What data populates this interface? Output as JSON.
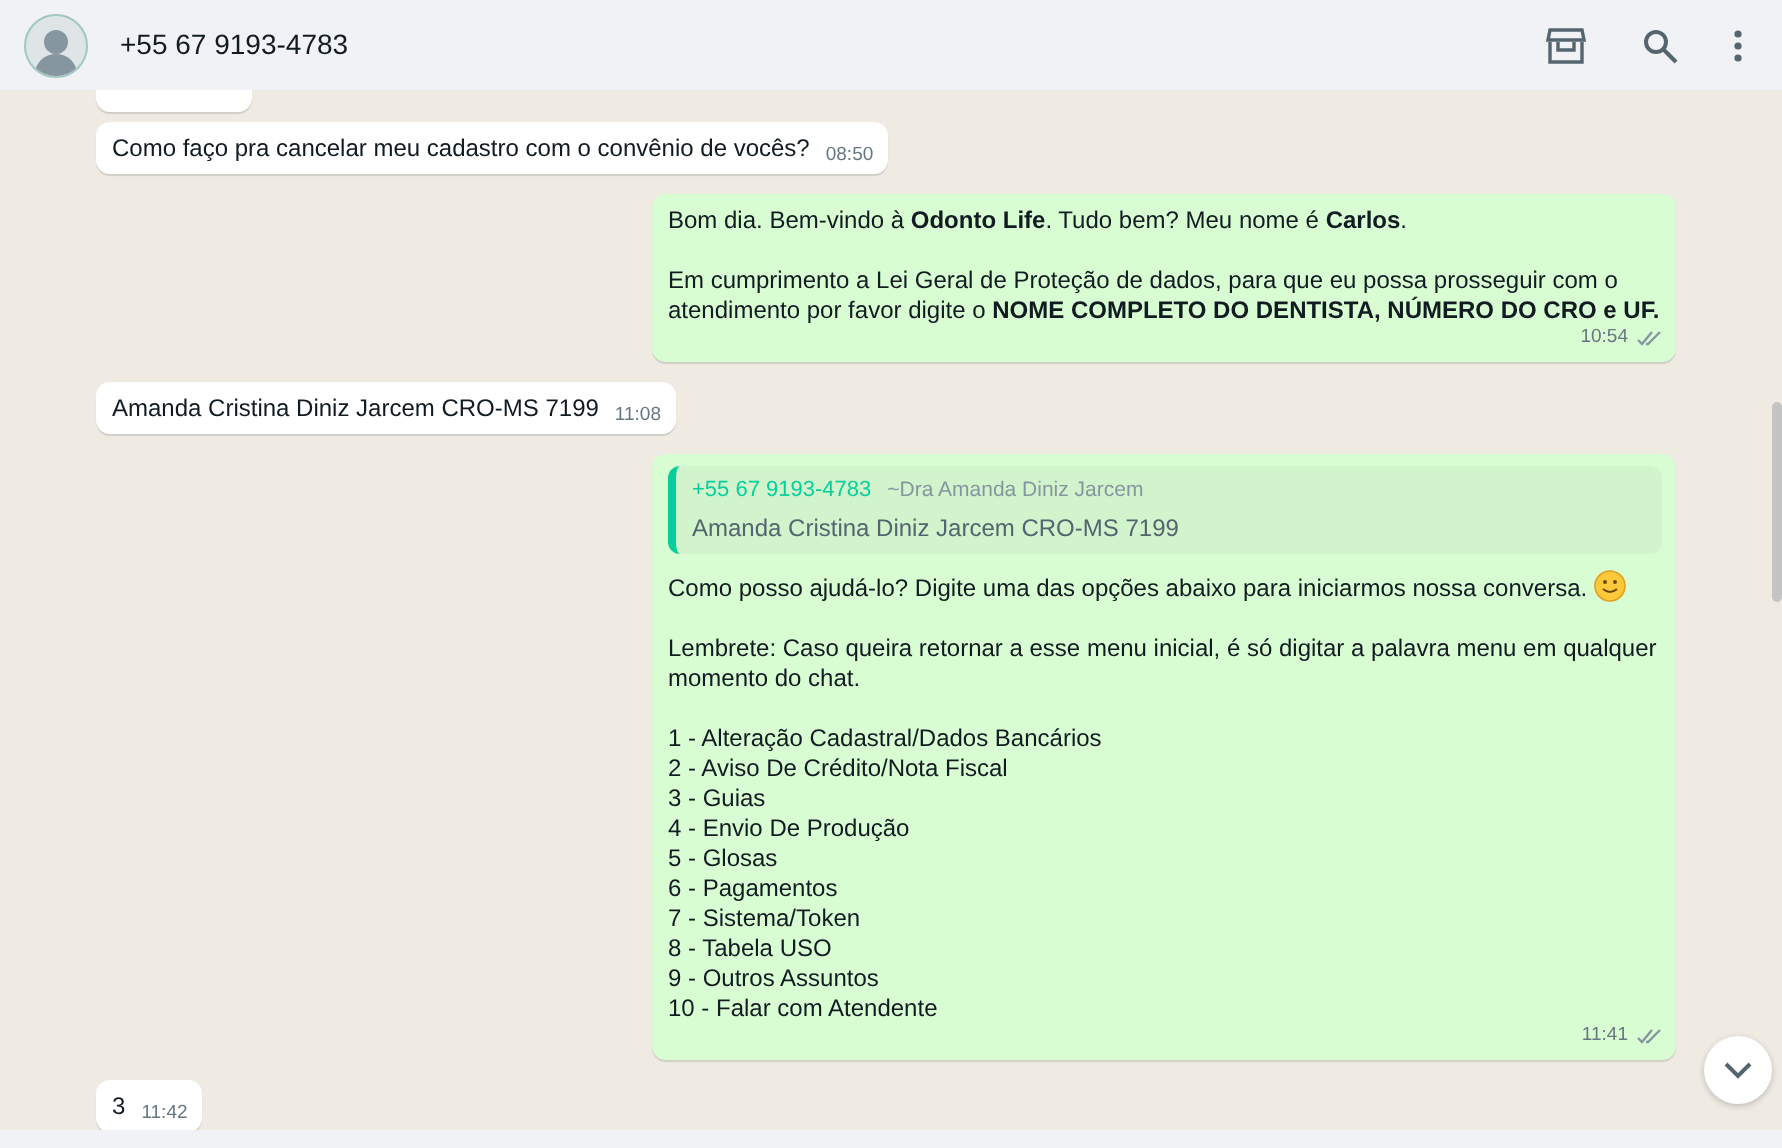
{
  "header": {
    "contact": "+55 67 9193-4783"
  },
  "messages": [
    {
      "kind": "incoming",
      "paragraphs": [
        {
          "kind": "plain",
          "text": "Como faço pra cancelar meu cadastro com o convênio de vocês?"
        }
      ],
      "time": "08:50"
    },
    {
      "kind": "outgoing",
      "paragraphs": [
        {
          "kind": "plain",
          "text": "Bom dia. Bem-vindo à **Odonto Life**. Tudo bem? Meu nome é **Carlos**."
        },
        {
          "kind": "plain",
          "text": "Em cumprimento a Lei Geral de Proteção de dados, para que eu possa prosseguir com o atendimento por favor digite o **NOME COMPLETO DO DENTISTA, NÚMERO DO CRO e UF.**"
        }
      ],
      "time": "10:54",
      "read": false
    },
    {
      "kind": "incoming",
      "paragraphs": [
        {
          "kind": "plain",
          "text": "Amanda Cristina Diniz Jarcem CRO-MS 7199"
        }
      ],
      "time": "11:08"
    },
    {
      "kind": "outgoing",
      "quote": {
        "author": "+55 67 9193-4783",
        "author_name": "~Dra Amanda Diniz Jarcem",
        "text": "Amanda Cristina Diniz Jarcem CRO-MS 7199"
      },
      "paragraphs": [
        {
          "kind": "emoji",
          "text": "Como posso ajudá-lo? Digite uma das opções abaixo para iniciarmos nossa conversa."
        },
        {
          "kind": "plain",
          "text": "Lembrete: Caso queira retornar a esse menu inicial, é só digitar a palavra menu em qualquer momento do chat."
        }
      ],
      "options": [
        "1 - Alteração Cadastral/Dados Bancários",
        "2 - Aviso De Crédito/Nota Fiscal",
        "3 - Guias",
        "4 - Envio De Produção",
        "5 - Glosas",
        "6 - Pagamentos",
        "7 - Sistema/Token",
        "8 - Tabela USO",
        "9 - Outros Assuntos",
        "10 - Falar com Atendente"
      ],
      "time": "11:41",
      "read": false
    },
    {
      "kind": "incoming",
      "paragraphs": [
        {
          "kind": "plain",
          "text": "3"
        }
      ],
      "time": "11:42"
    }
  ]
}
